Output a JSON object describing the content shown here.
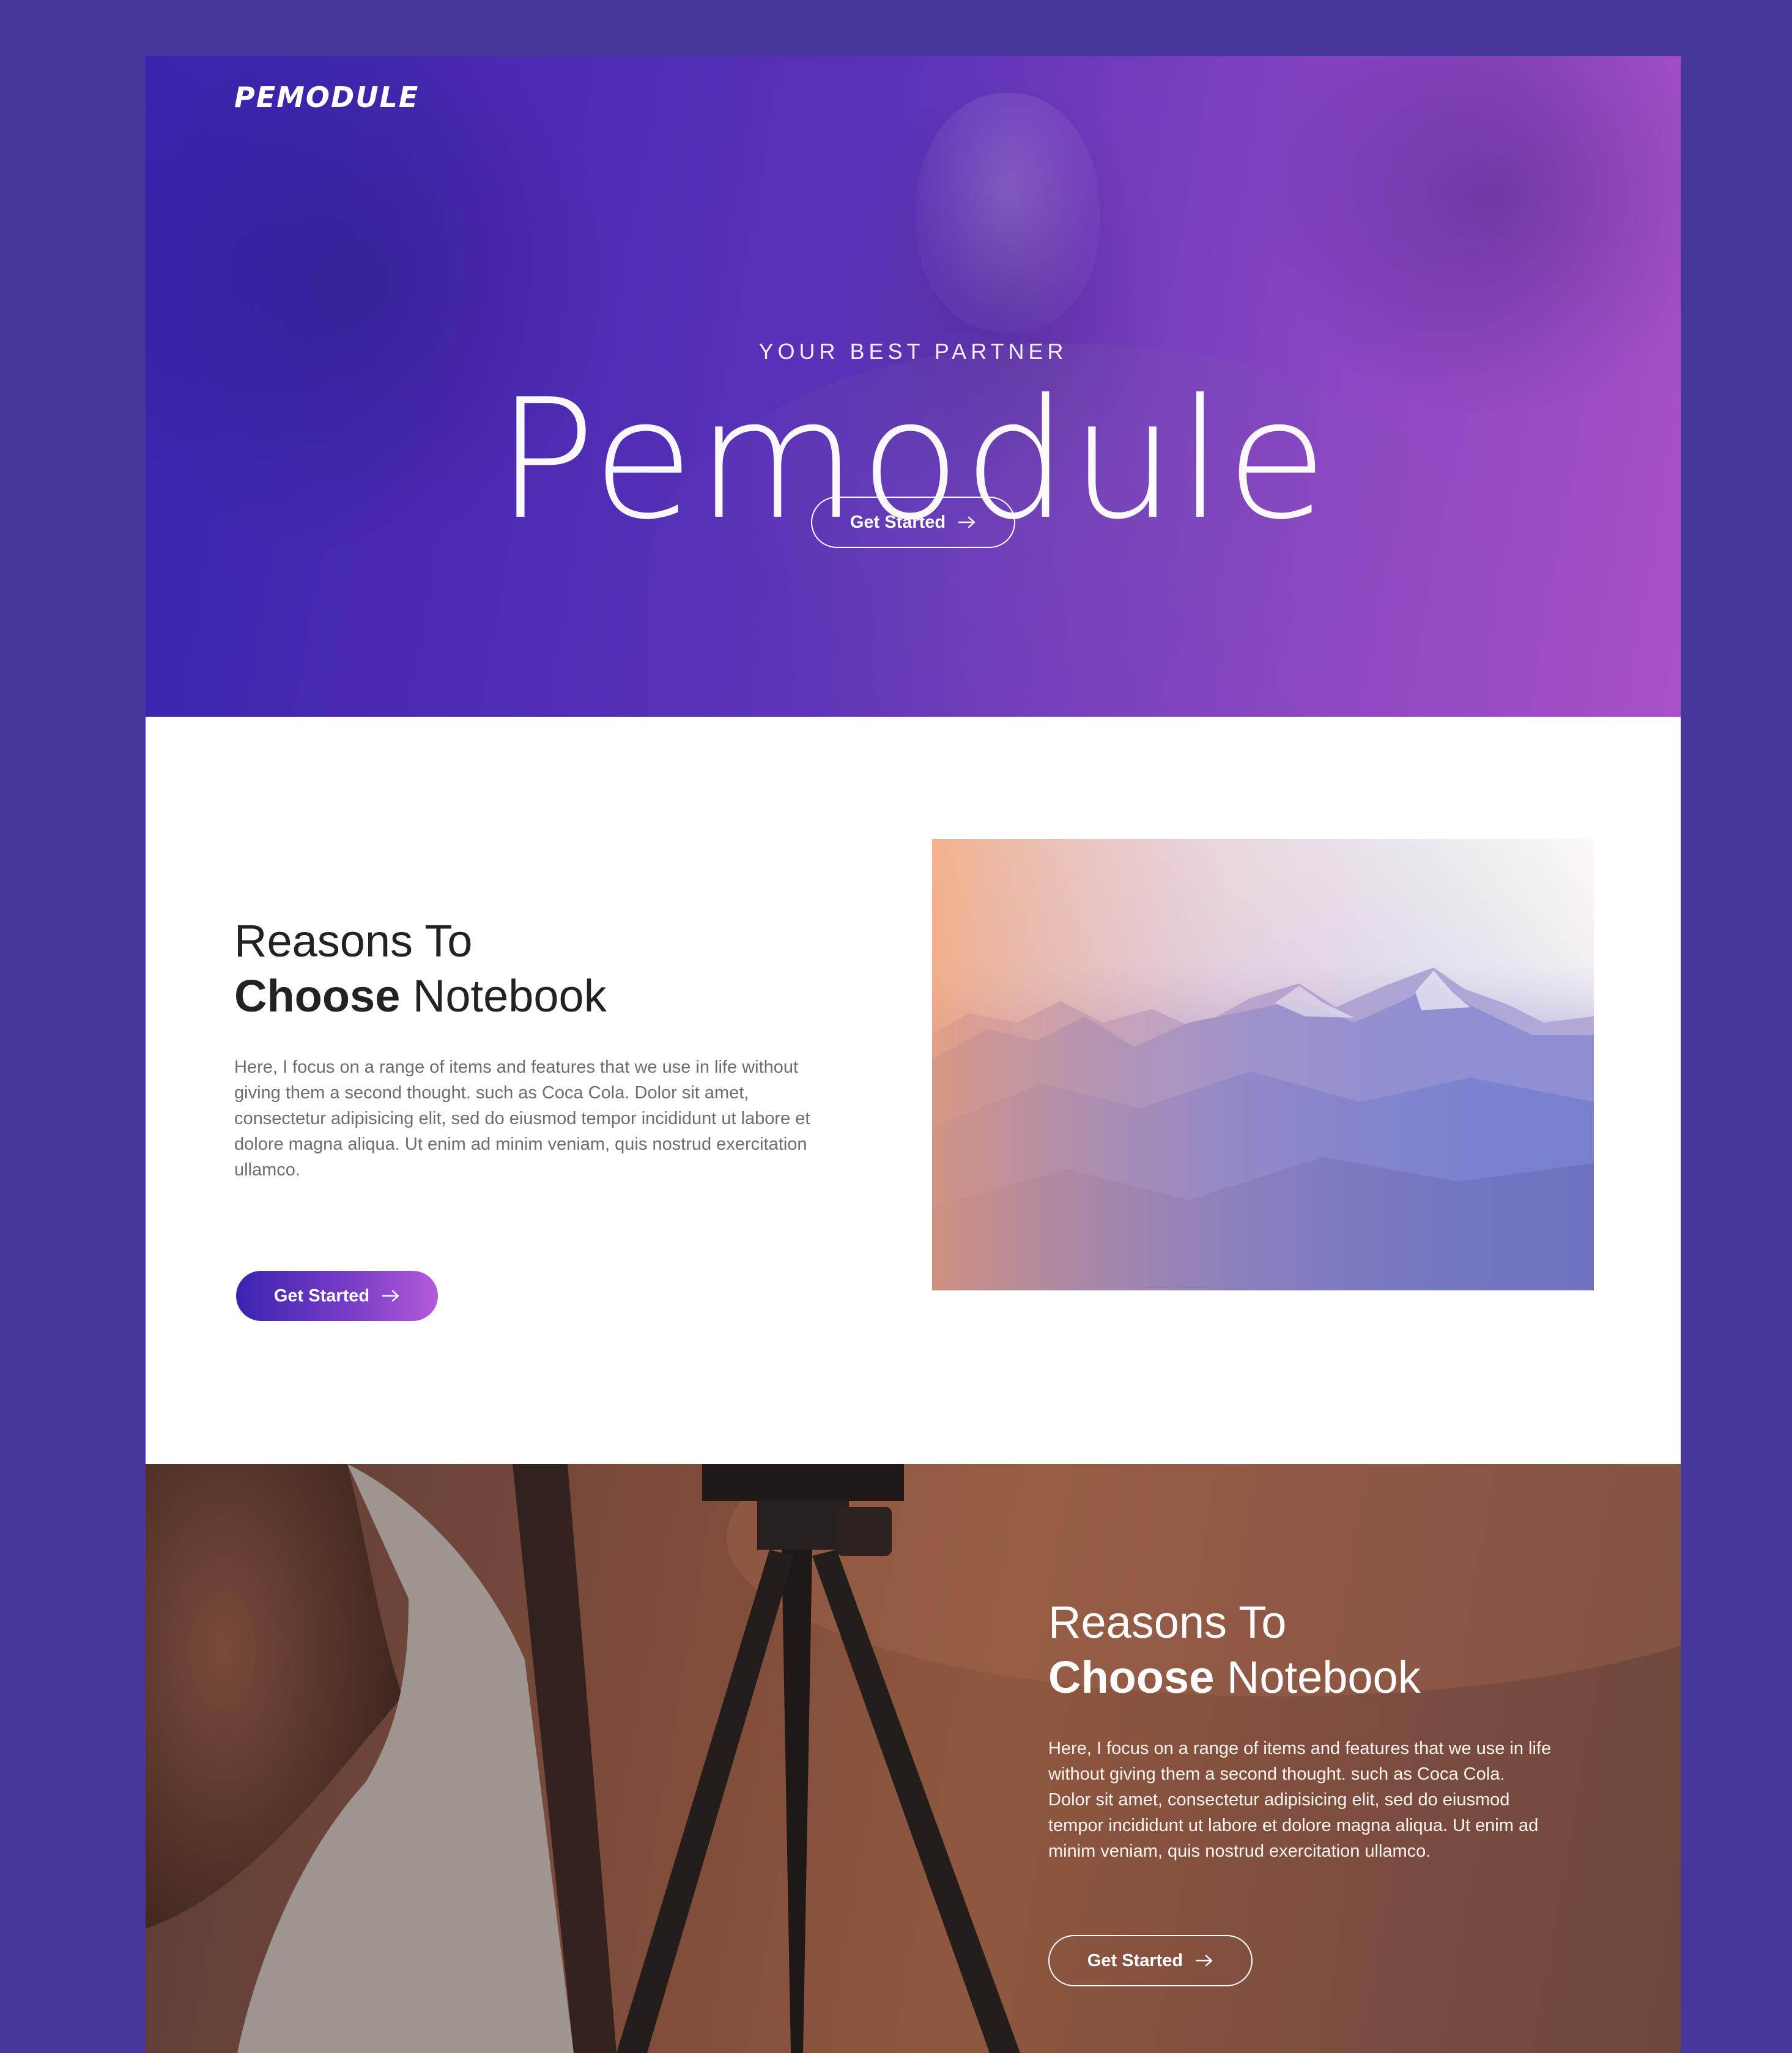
{
  "brand": {
    "logo_text": "PEMODULE"
  },
  "hero": {
    "eyebrow": "YOUR BEST PARTNER",
    "title": "Pemodule",
    "cta_label": "Get Started",
    "cta_icon": "arrow-right-icon"
  },
  "feature": {
    "heading_line1": "Reasons To",
    "heading_bold": "Choose",
    "heading_rest": "Notebook",
    "paragraph_lines": [
      "Here, I focus on a range of items and features that we use in life without",
      "giving them a second thought. such as Coca Cola. Dolor sit amet,",
      "consectetur adipisicing elit, sed do eiusmod tempor incididunt ut labore et",
      "dolore magna aliqua. Ut enim ad minim veniam, quis nostrud exercitation",
      "ullamco."
    ],
    "cta_label": "Get Started"
  },
  "section3": {
    "heading_line1": "Reasons To",
    "heading_bold": "Choose",
    "heading_rest": "Notebook",
    "paragraph_lines": [
      "Here, I focus on a range of items and features that we use in life",
      "without giving them a second thought. such as Coca Cola.",
      "Dolor sit amet, consectetur adipisicing elit, sed do eiusmod",
      "tempor incididunt ut labore et dolore magna aliqua. Ut enim ad",
      "minim veniam, quis nostrud exercitation ullamco."
    ],
    "cta_label": "Get Started"
  },
  "colors": {
    "outer_background": "#47369c",
    "hero_gradient_start": "#3a23ad",
    "hero_gradient_end": "#a851c8",
    "button_gradient_start": "#3a23b0",
    "button_gradient_end": "#b35bd9",
    "section3_background": "#8f573f"
  }
}
